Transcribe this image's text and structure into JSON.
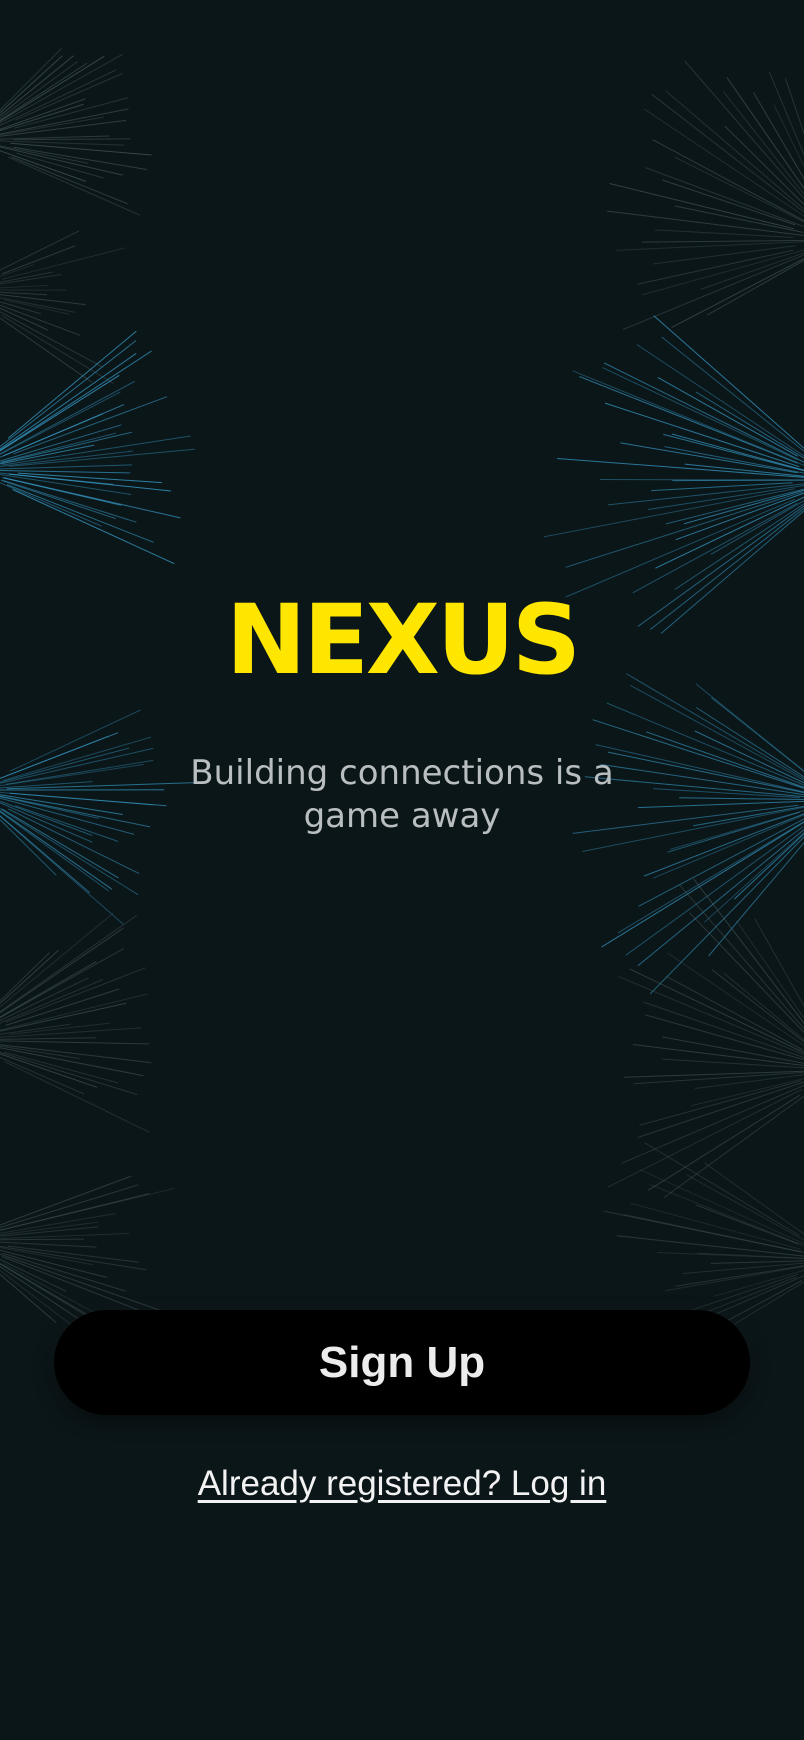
{
  "app": {
    "logo_text": "NEXUS",
    "tagline": "Building connections is a game away"
  },
  "actions": {
    "signup_label": "Sign Up",
    "login_link_label": "Already registered? Log in"
  },
  "colors": {
    "background": "#0b1619",
    "logo": "#ffe600",
    "tagline": "#b9bec0",
    "button_background": "#000000",
    "button_text": "#ececec",
    "link_text": "#f2f2f2",
    "line_blue": "#3aa6d6",
    "line_gray": "#5b6b6f"
  },
  "background": {
    "decoration": "radiating-line-bursts"
  }
}
